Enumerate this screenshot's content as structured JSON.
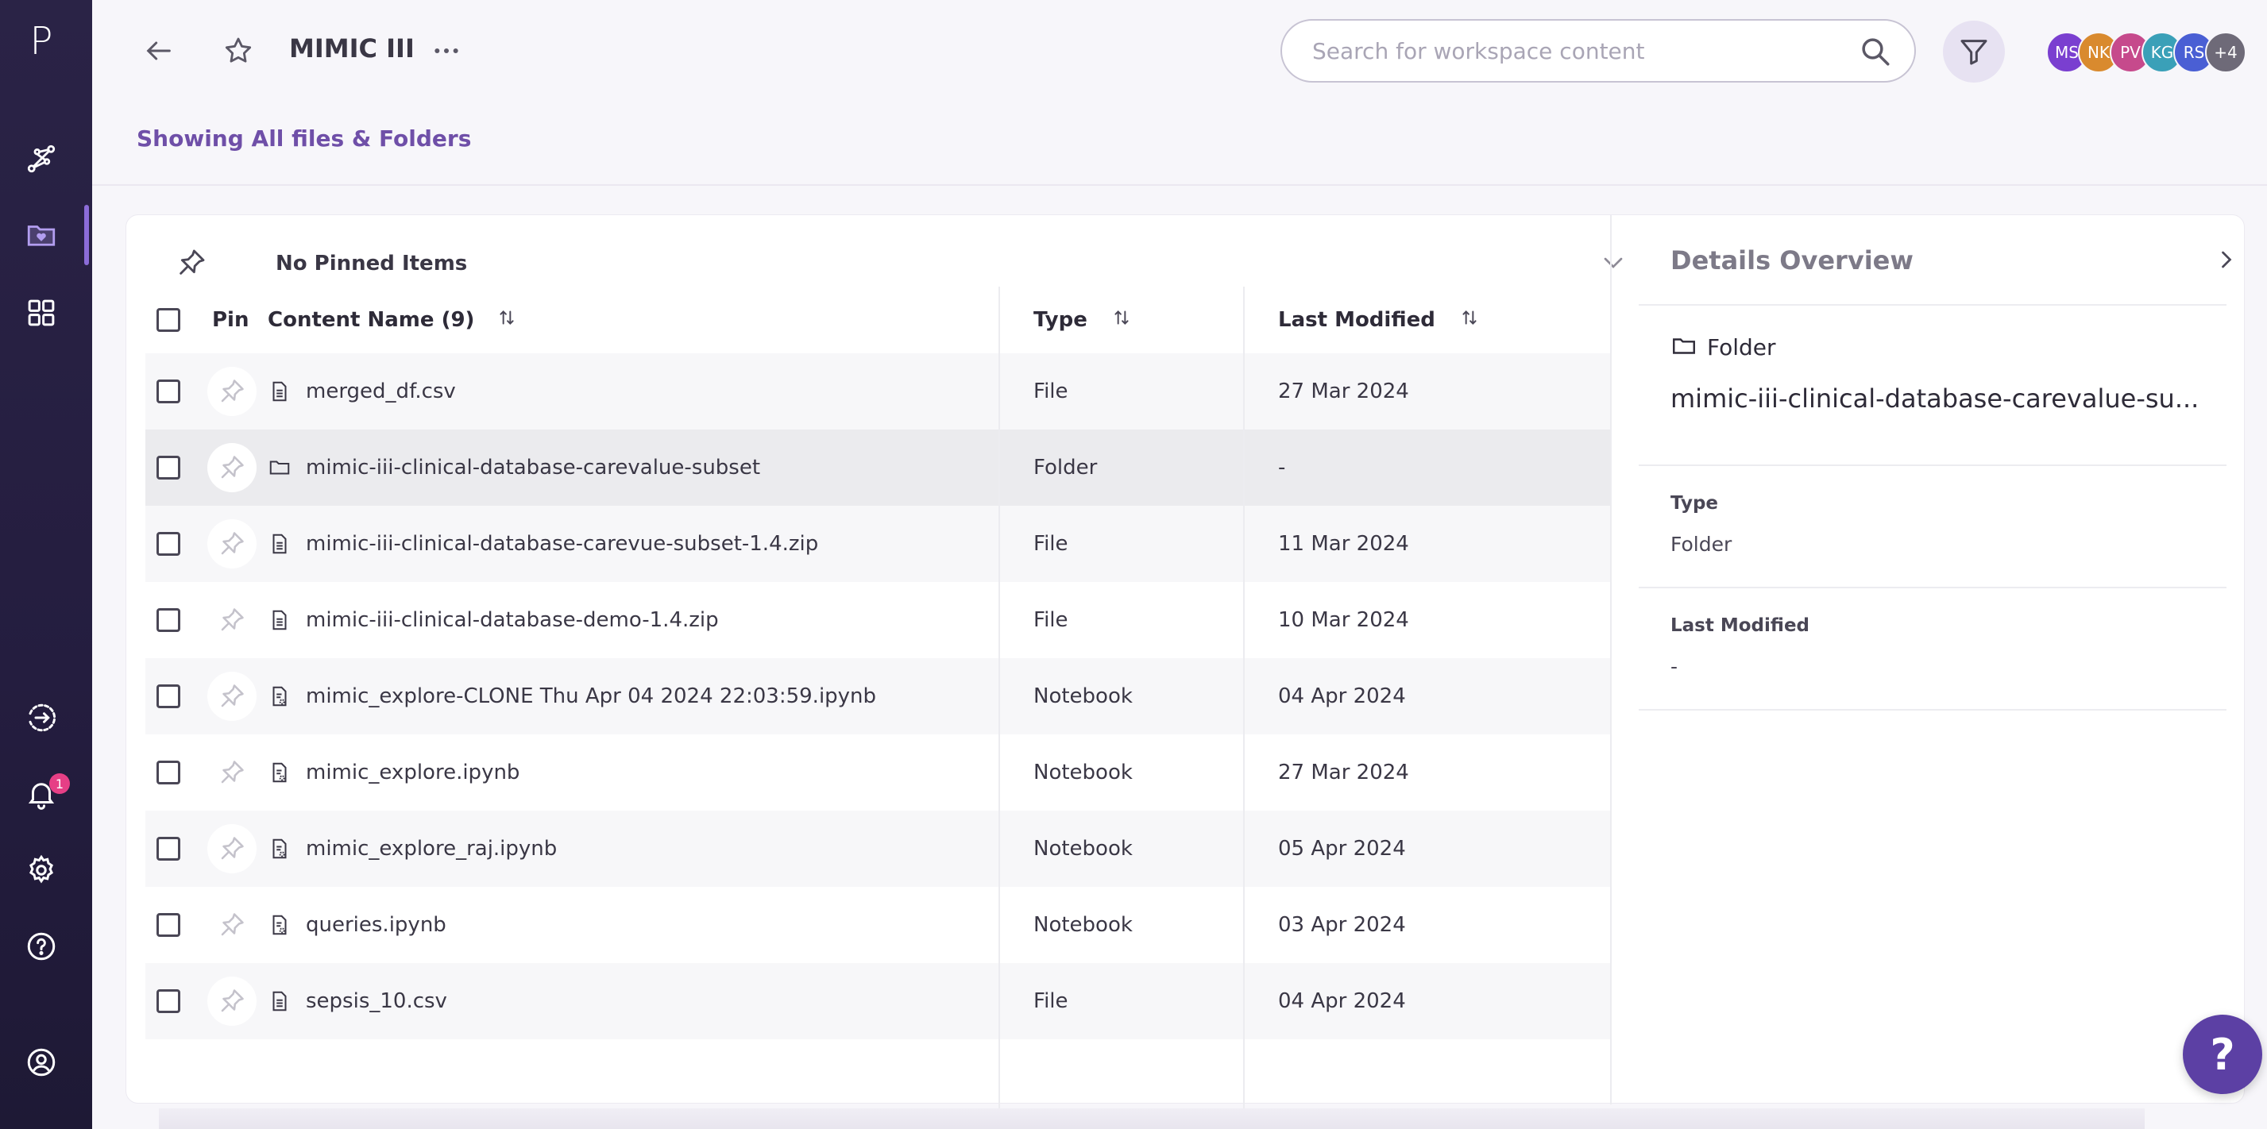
{
  "sidebar": {
    "logo": "P",
    "notification_count": "1"
  },
  "header": {
    "workspace_title": "MIMIC III",
    "search_placeholder": "Search for workspace content",
    "avatars": [
      {
        "initials": "MS",
        "color": "#7a3fd0"
      },
      {
        "initials": "NK",
        "color": "#d98a2e"
      },
      {
        "initials": "PV",
        "color": "#c64a8c"
      },
      {
        "initials": "KG",
        "color": "#3aa0b8"
      },
      {
        "initials": "RS",
        "color": "#4a5fd4"
      },
      {
        "initials": "+4",
        "color": "#6e6a78"
      }
    ]
  },
  "showing_label": "Showing All files & Folders",
  "pinned": {
    "label": "No Pinned Items"
  },
  "table": {
    "headers": {
      "pin": "Pin",
      "content_name": "Content Name (9)",
      "type": "Type",
      "last_modified": "Last Modified"
    },
    "rows": [
      {
        "name": "merged_df.csv",
        "type": "File",
        "modified": "27 Mar 2024",
        "icon": "file"
      },
      {
        "name": "mimic-iii-clinical-database-carevalue-subset",
        "type": "Folder",
        "modified": "-",
        "icon": "folder"
      },
      {
        "name": "mimic-iii-clinical-database-carevue-subset-1.4.zip",
        "type": "File",
        "modified": "11 Mar 2024",
        "icon": "file"
      },
      {
        "name": "mimic-iii-clinical-database-demo-1.4.zip",
        "type": "File",
        "modified": "10 Mar 2024",
        "icon": "file"
      },
      {
        "name": "mimic_explore-CLONE Thu Apr 04 2024 22:03:59.ipynb",
        "type": "Notebook",
        "modified": "04 Apr 2024",
        "icon": "notebook"
      },
      {
        "name": "mimic_explore.ipynb",
        "type": "Notebook",
        "modified": "27 Mar 2024",
        "icon": "notebook"
      },
      {
        "name": "mimic_explore_raj.ipynb",
        "type": "Notebook",
        "modified": "05 Apr 2024",
        "icon": "notebook"
      },
      {
        "name": "queries.ipynb",
        "type": "Notebook",
        "modified": "03 Apr 2024",
        "icon": "notebook"
      },
      {
        "name": "sepsis_10.csv",
        "type": "File",
        "modified": "04 Apr 2024",
        "icon": "file"
      }
    ]
  },
  "details": {
    "title": "Details Overview",
    "kind": "Folder",
    "name": "mimic-iii-clinical-database-carevalue-su...",
    "type_label": "Type",
    "type_value": "Folder",
    "modified_label": "Last Modified",
    "modified_value": "-"
  },
  "help_fab": "?"
}
